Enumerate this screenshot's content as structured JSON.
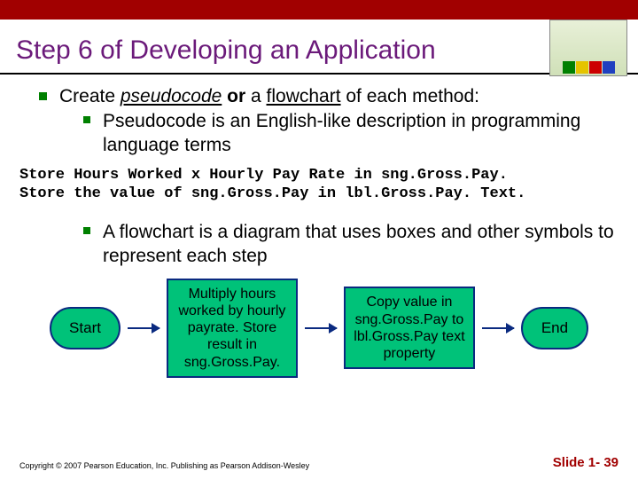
{
  "title": "Step 6 of Developing an Application",
  "bullets": {
    "b1_prefix": "Create ",
    "b1_pseudo": "pseudocode",
    "b1_bold": " or",
    "b1_mid": " a ",
    "b1_flow": "flowchart",
    "b1_suffix": " of each method:",
    "b2": "Pseudocode is an English-like description in programming language terms",
    "b3": "A flowchart is a diagram that uses boxes and other symbols to represent each step"
  },
  "code": "Store Hours Worked x Hourly Pay Rate in sng.Gross.Pay.\nStore the value of sng.Gross.Pay in lbl.Gross.Pay. Text.",
  "flow": {
    "start": "Start",
    "p1": "Multiply hours worked by hourly payrate. Store result in sng.Gross.Pay.",
    "p2": "Copy value in sng.Gross.Pay to lbl.Gross.Pay text property",
    "end": "End"
  },
  "footer": {
    "copyright": "Copyright © 2007 Pearson Education, Inc. Publishing as Pearson Addison-Wesley",
    "slide": "Slide 1- 39"
  }
}
